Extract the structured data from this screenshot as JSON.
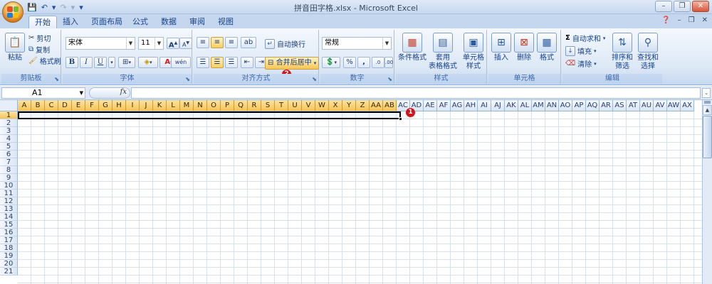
{
  "window": {
    "title": "拼音田字格.xlsx - Microsoft Excel",
    "qat": {
      "save": "💾",
      "undo": "↶",
      "undo_more": "▾",
      "redo": "↷",
      "redo_more": "▾",
      "customize": "▾"
    }
  },
  "tabs": [
    "开始",
    "插入",
    "页面布局",
    "公式",
    "数据",
    "审阅",
    "视图"
  ],
  "active_tab": "开始",
  "ribbon": {
    "clipboard": {
      "label": "剪贴板",
      "paste": "粘贴",
      "cut": "剪切",
      "copy": "复制",
      "format_painter": "格式刷"
    },
    "font": {
      "label": "字体",
      "font_name": "宋体",
      "font_size": "11",
      "grow": "A",
      "shrink": "A",
      "bold": "B",
      "italic": "I",
      "underline": "U",
      "font_color_letter": "A",
      "phonetic": "wén"
    },
    "alignment": {
      "label": "对齐方式",
      "wrap_text": "自动换行",
      "merge_center": "合并后居中"
    },
    "number": {
      "label": "数字",
      "format": "常规",
      "percent": "%",
      "comma": ","
    },
    "styles": {
      "label": "样式",
      "conditional": "条件格式",
      "table_line1": "套用",
      "table_line2": "表格格式",
      "cell_line1": "单元格",
      "cell_line2": "样式"
    },
    "cells": {
      "label": "单元格",
      "insert": "插入",
      "delete": "删除",
      "format": "格式"
    },
    "editing": {
      "label": "编辑",
      "autosum": "自动求和",
      "fill": "填充",
      "clear": "清除",
      "sort_line1": "排序和",
      "sort_line2": "筛选",
      "find_line1": "查找和",
      "find_line2": "选择"
    }
  },
  "formula_bar": {
    "name_box": "A1",
    "fx": "fx",
    "content": ""
  },
  "sheet": {
    "columns": [
      "A",
      "B",
      "C",
      "D",
      "E",
      "F",
      "G",
      "H",
      "I",
      "J",
      "K",
      "L",
      "M",
      "N",
      "O",
      "P",
      "Q",
      "R",
      "S",
      "T",
      "U",
      "V",
      "W",
      "X",
      "Y",
      "Z",
      "AA",
      "AB",
      "AC",
      "AD",
      "AE",
      "AF",
      "AG",
      "AH",
      "AI",
      "AJ",
      "AK",
      "AL",
      "AM",
      "AN",
      "AO",
      "AP",
      "AQ",
      "AR",
      "AS",
      "AT",
      "AU",
      "AV",
      "AW",
      "AX"
    ],
    "selected_columns": [
      "A",
      "B",
      "C",
      "D",
      "E",
      "F",
      "G",
      "H",
      "I",
      "J",
      "K",
      "L",
      "M",
      "N",
      "O",
      "P",
      "Q",
      "R",
      "S",
      "T",
      "U",
      "V",
      "W",
      "X",
      "Y",
      "Z",
      "AA",
      "AB"
    ],
    "rows": [
      "1",
      "2",
      "3",
      "4",
      "5",
      "6",
      "7",
      "8",
      "9",
      "10",
      "11",
      "12",
      "13",
      "14",
      "15",
      "16",
      "17",
      "18",
      "19",
      "20",
      "21"
    ],
    "selected_rows": [
      "1"
    ],
    "selection": "A1:AB1"
  },
  "annotations": {
    "step1": "1",
    "step2": "2"
  },
  "colors": {
    "accent": "#15428b",
    "selection": "#f7c454",
    "badge": "#d2141a"
  }
}
